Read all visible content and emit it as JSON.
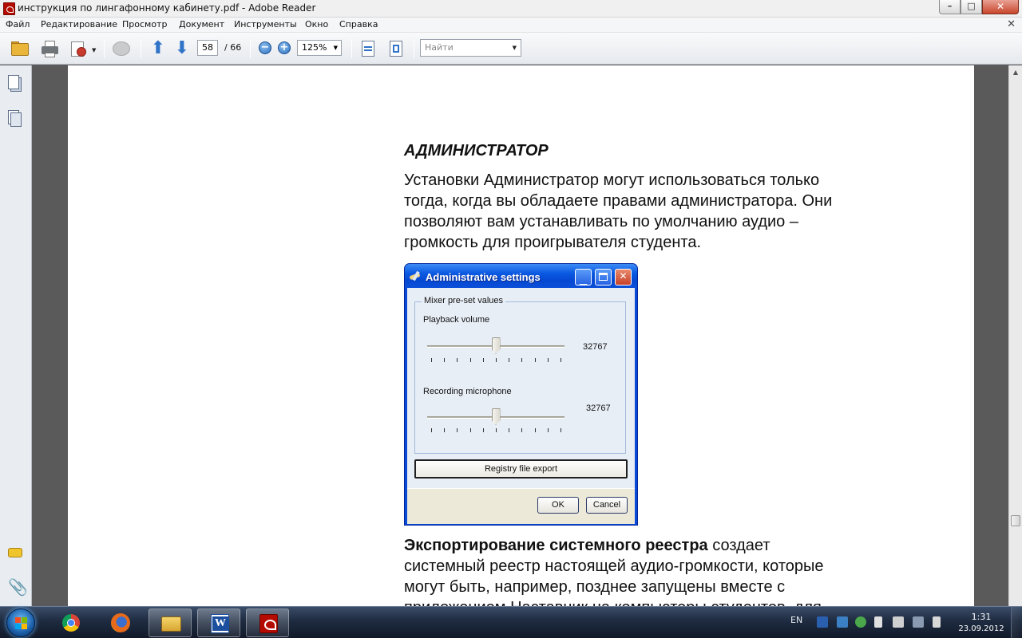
{
  "window": {
    "title": "инструкция по лингафонному кабинету.pdf - Adobe Reader",
    "controls": {
      "minimize": "–",
      "maximize": "□",
      "close": "✕"
    },
    "close_doc": "✕"
  },
  "menu": [
    "Файл",
    "Редактирование",
    "Просмотр",
    "Документ",
    "Инструменты",
    "Окно",
    "Справка"
  ],
  "toolbar": {
    "page_current": "58",
    "page_total": "/ 66",
    "zoom": "125%",
    "search_placeholder": "Найти",
    "icons": [
      "open-folder-icon",
      "print-icon",
      "share-icon",
      "comment-icon",
      "arrow-up-icon",
      "arrow-down-icon",
      "zoom-out-icon",
      "zoom-in-icon",
      "fit-width-icon",
      "fit-page-icon"
    ]
  },
  "document": {
    "heading": "АДМИНИСТРАТОР",
    "intro_lines": [
      "Установки Администратор могут использоваться только",
      "тогда, когда вы обладаете правами администратора. Они",
      "позволяют вам устанавливать по умолчанию аудио –",
      "громкость для проигрывателя студента."
    ],
    "export_bold": "Экспортирование системного реестра",
    "export_lines": [
      " создает",
      "системный реестр настоящей аудио-громкости, которые",
      "могут быть, например, позднее запущены вместе с",
      "приложением Наставник на компьютеры студентов, для"
    ]
  },
  "dialog": {
    "title": "Administrative settings",
    "group_label": "Mixer pre-set values",
    "playback_label": "Playback volume",
    "playback_value": "32767",
    "playback_fraction": 0.5,
    "recording_label": "Recording microphone",
    "recording_value": "32767",
    "recording_fraction": 0.5,
    "export_button": "Registry file export",
    "ok_button": "OK",
    "cancel_button": "Cancel"
  },
  "taskbar": {
    "apps": [
      "chrome-icon",
      "firefox-icon",
      "explorer-icon",
      "word-icon",
      "adobe-reader-icon"
    ],
    "language": "EN",
    "time": "1:31",
    "date": "23.09.2012"
  }
}
